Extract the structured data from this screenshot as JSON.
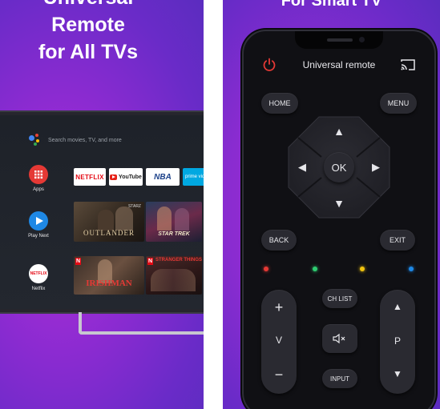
{
  "left_panel": {
    "headline": [
      "Universal",
      "Remote",
      "for All TVs"
    ],
    "tv": {
      "search_placeholder": "Search movies, TV, and more",
      "sidebar": [
        {
          "label": "Apps",
          "icon": "apps-grid-icon",
          "color": "#e53935"
        },
        {
          "label": "Play Next",
          "icon": "play-icon",
          "color": "#1e88e5"
        },
        {
          "label": "Netflix",
          "icon": "netflix-icon",
          "color": "#ffffff"
        }
      ],
      "app_chips": [
        "NETFLIX",
        "YouTube",
        "NBA",
        "prime video",
        "video"
      ],
      "tiles_row1": [
        "OUTLANDER",
        "STAR TREK",
        ""
      ],
      "tiles_row2": [
        "IRISHMAN",
        "STRANGER THINGS",
        ""
      ],
      "starz": "STARZ",
      "badge_n": "N"
    }
  },
  "right_panel": {
    "title": "For Smart TV",
    "app_title": "Universal remote",
    "buttons": {
      "home": "HOME",
      "menu": "MENU",
      "ok": "OK",
      "back": "BACK",
      "exit": "EXIT",
      "ch_list": "CH LIST",
      "input": "INPUT",
      "vol_up": "+",
      "vol_label": "V",
      "vol_down": "−",
      "ch_up": "▲",
      "ch_label": "P",
      "ch_down": "▼",
      "arrow_up": "▲",
      "arrow_down": "▼",
      "arrow_left": "◀",
      "arrow_right": "▶"
    },
    "color_buttons": [
      "#e53935",
      "#2ecc71",
      "#f1c40f",
      "#1e88e5"
    ],
    "power_color": "#e53935"
  }
}
